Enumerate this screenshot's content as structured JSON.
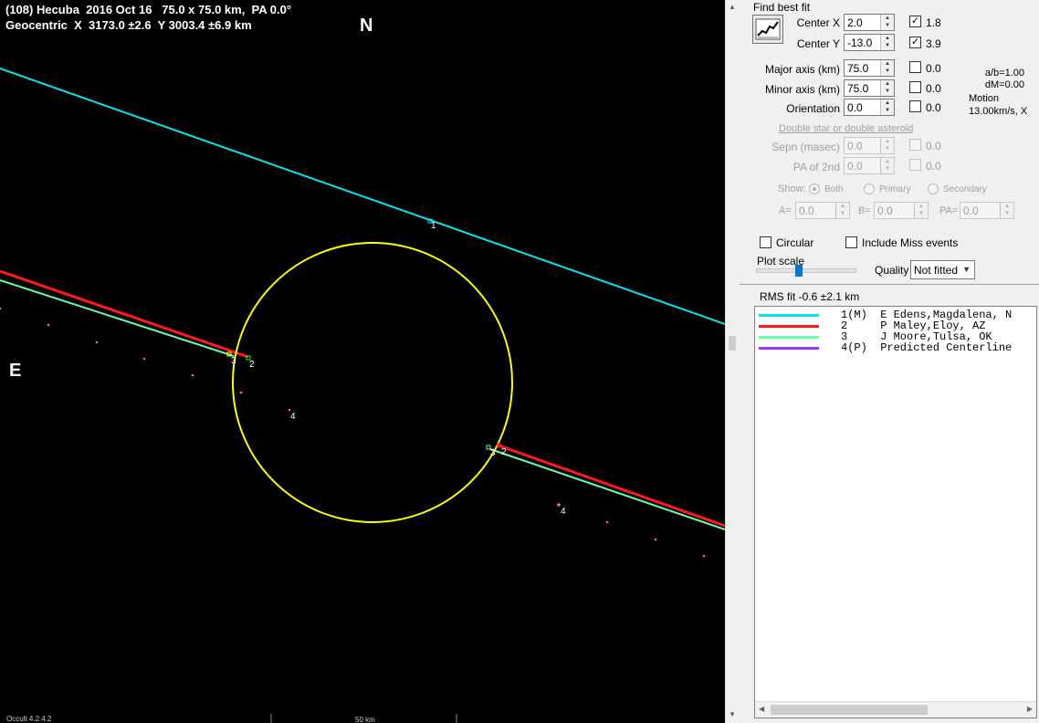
{
  "plot": {
    "title_line1": "(108) Hecuba  2016 Oct 16   75.0 x 75.0 km,  PA 0.0°",
    "title_line2": "Geocentric  X  3173.0 ±2.6  Y 3003.4 ±6.9 km",
    "north_label": "N",
    "east_label": "E",
    "footer_version": "Occult 4.2.4.2",
    "scale_label": "50 km",
    "colors": {
      "ellipse": "#ffff00",
      "chord1": "#00e5ee",
      "chord2": "#ff1a1a",
      "chord3": "#66ffaa",
      "predicted": "#ff6688"
    },
    "chord_labels": [
      "1",
      "2",
      "3",
      "4"
    ]
  },
  "panel": {
    "find_best_fit": "Find best fit",
    "center_x": {
      "label": "Center X",
      "value": "2.0",
      "checked": true,
      "fit_value": "1.8"
    },
    "center_y": {
      "label": "Center Y",
      "value": "-13.0",
      "checked": true,
      "fit_value": "3.9"
    },
    "major_axis": {
      "label": "Major axis (km)",
      "value": "75.0",
      "checked": false,
      "fit_value": "0.0"
    },
    "minor_axis": {
      "label": "Minor axis (km)",
      "value": "75.0",
      "checked": false,
      "fit_value": "0.0"
    },
    "orientation": {
      "label": "Orientation",
      "value": "0.0",
      "checked": false,
      "fit_value": "0.0"
    },
    "ratio_ab": "a/b=1.00",
    "dm": "dM=0.00",
    "motion_label": "Motion",
    "motion_value": "13.00km/s, X",
    "double_star_link": "Double star  or  double asteroid",
    "sepn": {
      "label": "Sepn (masec)",
      "value": "0.0",
      "fit_value": "0.0"
    },
    "pa_2nd": {
      "label": "PA of 2nd",
      "value": "0.0",
      "fit_value": "0.0"
    },
    "show_label": "Show:",
    "show_options": [
      "Both",
      "Primary",
      "Secondary"
    ],
    "a_field": {
      "label": "A=",
      "value": "0.0"
    },
    "b_field": {
      "label": "B=",
      "value": "0.0"
    },
    "pa_field": {
      "label": "PA=",
      "value": "0.0"
    },
    "circular": {
      "label": "Circular",
      "checked": false
    },
    "include_miss": {
      "label": "Include Miss events",
      "checked": false
    },
    "plot_scale": "Plot scale",
    "quality_label": "Quality",
    "quality_value": "Not fitted",
    "rms_fit": "RMS fit  -0.6 ±2.1 km",
    "observers": [
      {
        "text": "1(M)  E Edens,Magdalena, N",
        "color": "#00e5ee"
      },
      {
        "text": "2     P Maley,Eloy, AZ",
        "color": "#ff1a1a"
      },
      {
        "text": "3     J Moore,Tulsa, OK",
        "color": "#66ffaa"
      },
      {
        "text": "4(P)  Predicted Centerline",
        "color": "#9933ff"
      }
    ]
  }
}
